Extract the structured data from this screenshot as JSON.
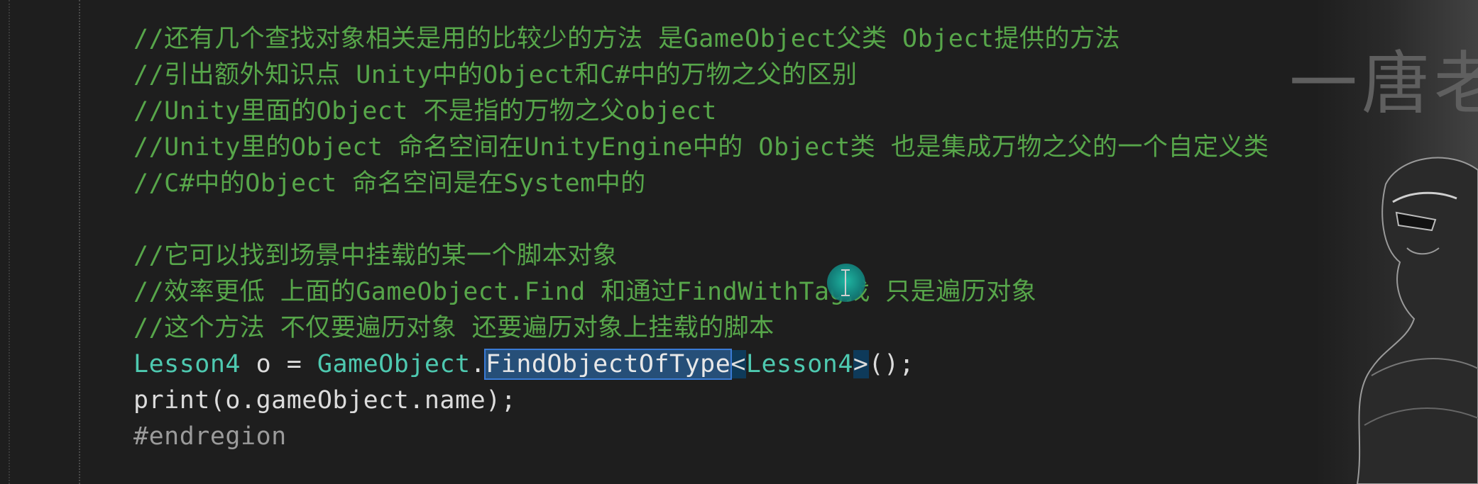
{
  "editor": {
    "lines": [
      {
        "text": "//还有几个查找对象相关是用的比较少的方法 是GameObject父类 Object提供的方法"
      },
      {
        "text": "//引出额外知识点 Unity中的Object和C#中的万物之父的区别"
      },
      {
        "text": "//Unity里面的Object 不是指的万物之父object"
      },
      {
        "text": "//Unity里的Object 命名空间在UnityEngine中的 Object类 也是集成万物之父的一个自定义类"
      },
      {
        "text": "//C#中的Object 命名空间是在System中的"
      },
      {
        "text": ""
      },
      {
        "text": "//它可以找到场景中挂载的某一个脚本对象"
      },
      {
        "text": "//效率更低 上面的GameObject.Find 和通过FindWithTag找 只是遍历对象"
      },
      {
        "text": "//这个方法 不仅要遍历对象 还要遍历对象上挂载的脚本"
      }
    ],
    "code_line_1": {
      "type1": "Lesson4",
      "var": " o = ",
      "class": "GameObject",
      "dot": ".",
      "method": "FindObjectOfType",
      "lt": "<",
      "generic": "Lesson4",
      "gt": ">",
      "tail": "();"
    },
    "code_line_2": {
      "fn": "print",
      "args": "(o.gameObject.name);"
    },
    "code_line_3": "#endregion"
  },
  "watermark": {
    "text": "一唐老"
  },
  "colors": {
    "background": "#1e1e1e",
    "comment": "#57a64a",
    "type": "#4ec9b0",
    "selection": "#264f78"
  }
}
